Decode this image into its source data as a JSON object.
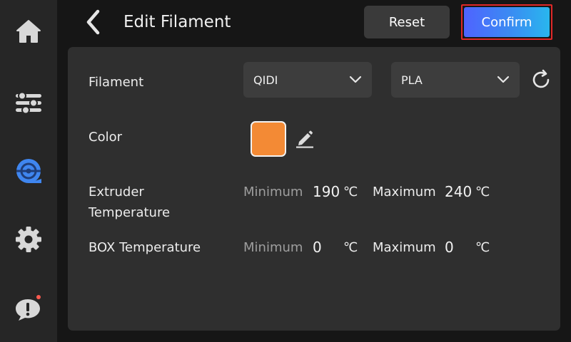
{
  "header": {
    "title": "Edit Filament",
    "reset_label": "Reset",
    "confirm_label": "Confirm"
  },
  "sidebar": {
    "items": [
      {
        "icon": "home-icon"
      },
      {
        "icon": "sliders-icon"
      },
      {
        "icon": "filament-spool-icon",
        "active": true
      },
      {
        "icon": "gear-icon"
      },
      {
        "icon": "alert-chat-icon",
        "badge": true
      }
    ]
  },
  "form": {
    "filament": {
      "label": "Filament",
      "brand": "QIDI",
      "type": "PLA"
    },
    "color": {
      "label": "Color",
      "value": "#f38a35"
    },
    "extruder": {
      "label_line1": "Extruder",
      "label_line2": "Temperature",
      "min_label": "Minimum",
      "min_value": "190",
      "min_unit": "℃",
      "max_label": "Maximum",
      "max_value": "240",
      "max_unit": "℃"
    },
    "box": {
      "label": "BOX Temperature",
      "min_label": "Minimum",
      "min_value": "0",
      "min_unit": "℃",
      "max_label": "Maximum",
      "max_value": "0",
      "max_unit": "℃"
    }
  },
  "colors": {
    "accent_blue": "#3a8cf2",
    "highlight_red": "#e02828",
    "badge_red": "#ff5a4f"
  }
}
